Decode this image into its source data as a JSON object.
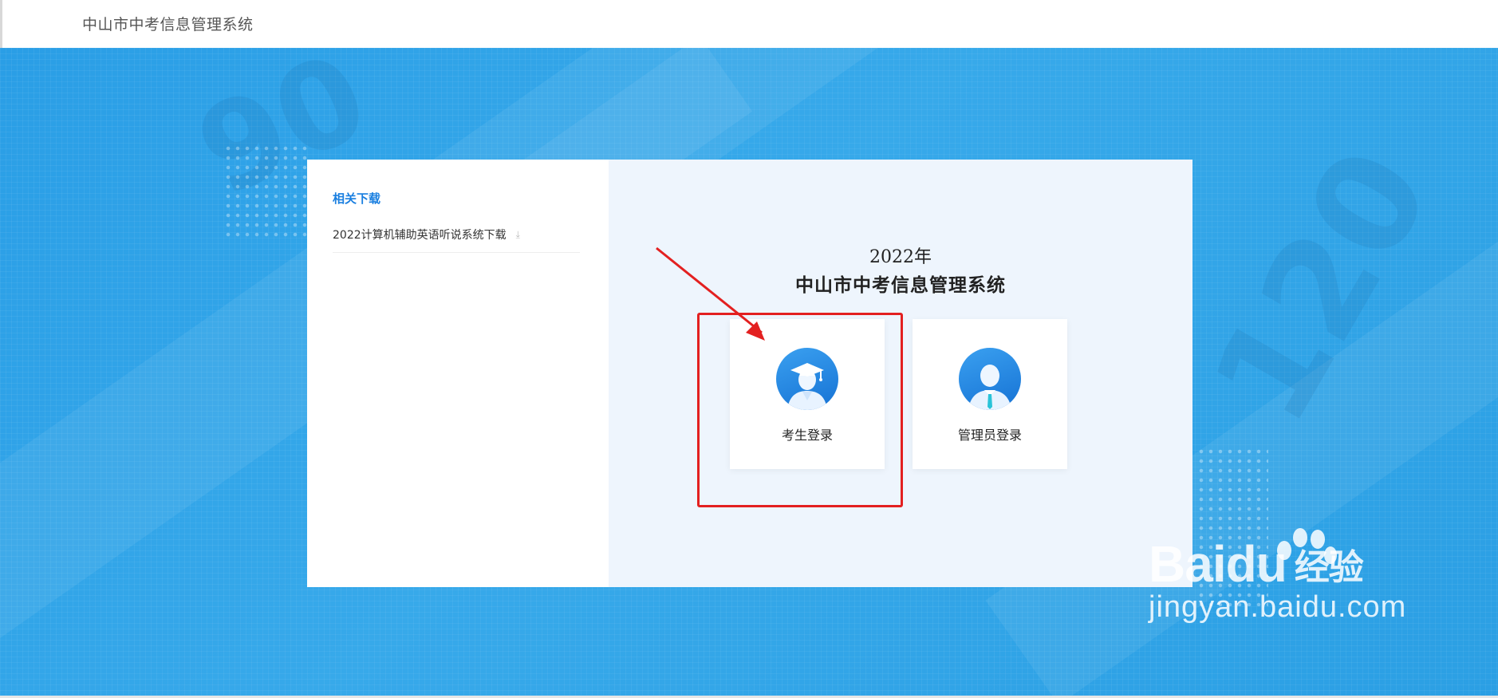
{
  "header": {
    "site_title": "中山市中考信息管理系统"
  },
  "downloads": {
    "heading": "相关下载",
    "items": [
      {
        "label": "2022计算机辅助英语听说系统下载",
        "icon": "download-icon"
      }
    ]
  },
  "main": {
    "year": "2022年",
    "title": "中山市中考信息管理系统",
    "logins": [
      {
        "label": "考生登录",
        "icon": "student-avatar-icon"
      },
      {
        "label": "管理员登录",
        "icon": "admin-avatar-icon"
      }
    ]
  },
  "watermark": {
    "brand": "Bai",
    "brand_suffix": "du",
    "cn": "经验",
    "url": "jingyan.baidu.com"
  },
  "colors": {
    "accent": "#1a7fe0",
    "hero_bg": "#2a9ee6",
    "highlight": "#e32020"
  }
}
